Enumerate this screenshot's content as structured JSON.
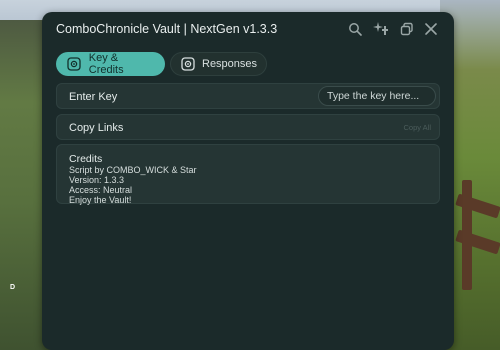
{
  "window": {
    "title": "ComboChronicle Vault | NextGen v1.3.3"
  },
  "titlebar_icons": [
    "search-icon",
    "sparkles-icon",
    "restore-window-icon",
    "close-icon"
  ],
  "tabs": [
    {
      "label": "Key & Credits",
      "icon": "shield-icon",
      "active": true
    },
    {
      "label": "Responses",
      "icon": "shield-icon",
      "active": false
    }
  ],
  "key_row": {
    "label": "Enter Key",
    "placeholder": "Type the key here..."
  },
  "links_row": {
    "label": "Copy Links",
    "hint": "Copy All"
  },
  "credits": {
    "title": "Credits",
    "lines": [
      "Script by COMBO_WICK & Star",
      "Version: 1.3.3",
      "Access: Neutral",
      "Enjoy the Vault!"
    ]
  },
  "background": {
    "corner_label": "D"
  },
  "colors": {
    "accent": "#4fb8ac",
    "window_bg": "#1b2a2a",
    "row_bg": "#253534"
  }
}
